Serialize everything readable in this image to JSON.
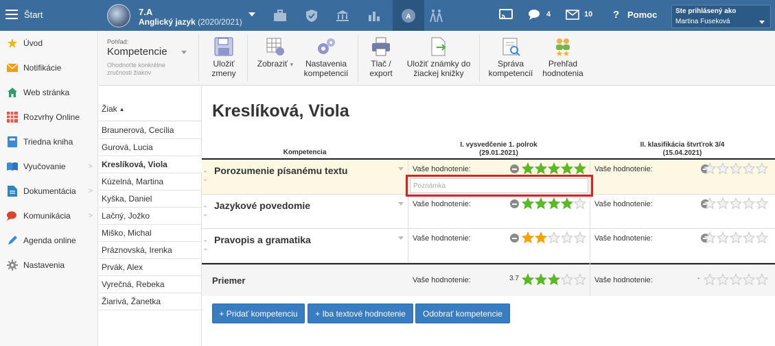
{
  "topbar": {
    "start_label": "Štart",
    "class_name": "7.A",
    "subject": "Anglický jazyk",
    "year": "(2020/2021)",
    "chat_count": "4",
    "mail_count": "10",
    "help_label": "Pomoc",
    "logged_in_label": "Ste prihlásený ako",
    "user_name": "Martina Fuseková"
  },
  "sidebar": {
    "items": [
      {
        "label": "Úvod",
        "icon": "star-icon"
      },
      {
        "label": "Notifikácie",
        "icon": "envelope-icon"
      },
      {
        "label": "Web stránka",
        "icon": "home-icon"
      },
      {
        "label": "Rozvrhy Online",
        "icon": "calendar-grid-icon"
      },
      {
        "label": "Triedna kniha",
        "icon": "book-icon"
      },
      {
        "label": "Vyučovanie",
        "icon": "open-book-icon"
      },
      {
        "label": "Dokumentácia",
        "icon": "document-icon"
      },
      {
        "label": "Komunikácia",
        "icon": "chat-icon"
      },
      {
        "label": "Agenda online",
        "icon": "pen-icon"
      },
      {
        "label": "Nastavenia",
        "icon": "gear-icon"
      }
    ]
  },
  "toolbar": {
    "view_label": "Pohľad:",
    "view_value": "Kompetencie",
    "view_hint": "Ohodnoťte konkrétne zručnosti žiakov",
    "save_l1": "Uložiť",
    "save_l2": "zmeny",
    "show_label": "Zobraziť",
    "settings_l1": "Nastavenia",
    "settings_l2": "kompetencií",
    "print_l1": "Tlač /",
    "print_l2": "export",
    "savegrades_l1": "Uložiť známky do",
    "savegrades_l2": "žiackej knižky",
    "manage_l1": "Správa",
    "manage_l2": "kompetencií",
    "overview_l1": "Prehľad",
    "overview_l2": "hodnotenia"
  },
  "students": {
    "header": "Žiak",
    "list": [
      "Braunerová, Cecília",
      "Gurová, Lucia",
      "Kreslíková, Viola",
      "Kúzelná, Martina",
      "Kyška, Daniel",
      "Lačný, Jožko",
      "Miško, Michal",
      "Práznovská, Irenka",
      "Prvák, Alex",
      "Vyrečná, Rebeka",
      "Žiarivá, Žanetka"
    ],
    "selected_index": 2
  },
  "main": {
    "student_title": "Kreslíková, Viola",
    "col_competence": "Kompetencia",
    "period1_title": "I. vysvedčenie 1. polrok",
    "period1_date": "(29.01.2021)",
    "period2_title": "II. klasifikácia štvrťrok 3/4",
    "period2_date": "(15.04.2021)",
    "eval_label": "Vaše hodnotenie:",
    "note_placeholder": "Poznámka",
    "competences": [
      {
        "name": "Porozumenie písanému textu",
        "p1_stars": 5,
        "p2_stars": 0
      },
      {
        "name": "Jazykové povedomie",
        "p1_stars": 4,
        "p2_stars": 0
      },
      {
        "name": "Pravopis a gramatika",
        "p1_stars": 2,
        "p2_stars": 0
      }
    ],
    "average_label": "Priemer",
    "average_p1_value": "3.7",
    "average_p1_stars": 3,
    "average_p2_value": "-",
    "average_p2_stars": 0,
    "add_competence_btn": "+ Pridať kompetenciu",
    "text_only_btn": "+ Iba textové hodnotenie",
    "remove_btn": "Odobrať kompetencie"
  },
  "colors": {
    "topbar": "#3a6d9e",
    "star_green": "#5cb829",
    "star_orange": "#f0a30a",
    "highlight_row": "#fdf8e3",
    "button_blue": "#3a7cc2",
    "annotation_red": "#e02020"
  }
}
